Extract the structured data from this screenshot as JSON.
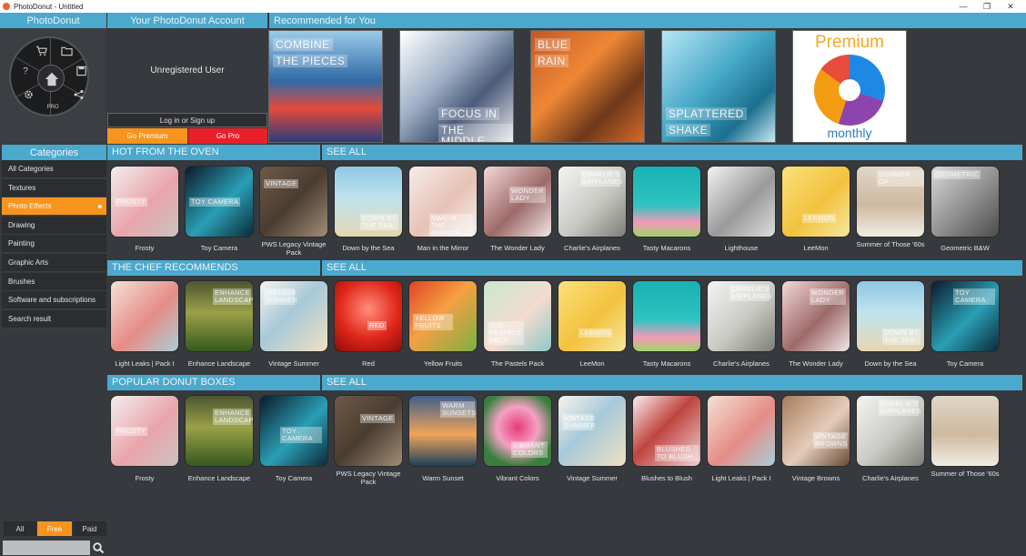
{
  "window": {
    "title": "PhotoDonut - Untitled",
    "controls": [
      "—",
      "❐",
      "✕"
    ]
  },
  "header": {
    "app_name": "PhotoDonut",
    "account": "Your PhotoDonut Account",
    "recommended": "Recommended for You"
  },
  "wheel": {
    "pro": "PRO",
    "help": "?"
  },
  "account": {
    "user": "Unregistered User",
    "login": "Log in or Sign up",
    "premium": "Go Premium",
    "pro": "Go Pro"
  },
  "recommended": [
    {
      "lines": [
        "COMBINE",
        "THE PIECES"
      ]
    },
    {
      "lines": [
        "FOCUS IN",
        "THE MIDDLE"
      ]
    },
    {
      "lines": [
        "BLUE",
        "RAIN"
      ]
    },
    {
      "lines": [
        "SPLATTERED",
        "SHAKE"
      ]
    }
  ],
  "premium_card": {
    "title": "Premium",
    "subtitle": "monthly"
  },
  "categories": {
    "title": "Categories",
    "items": [
      "All Categories",
      "Textures",
      "Photo Effects",
      "Drawing",
      "Painting",
      "Graphic Arts",
      "Brushes",
      "Software and subscriptions",
      "Search result"
    ],
    "active_index": 2
  },
  "filters": {
    "all": "All",
    "free": "Free",
    "paid": "Paid"
  },
  "search": {
    "placeholder": ""
  },
  "sections": [
    {
      "title": "HOT FROM THE OVEN",
      "see_all": "SEE ALL",
      "items": [
        {
          "label": "Frosty",
          "overlay": "FROSTY"
        },
        {
          "label": "Toy Camera",
          "overlay": "TOY CAMERA"
        },
        {
          "label": "PWS Legacy Vintage Pack",
          "overlay": "VINTAGE"
        },
        {
          "label": "Down by the Sea",
          "overlay": "DOWN BY THE SEA"
        },
        {
          "label": "Man in the Mirror",
          "overlay": "MAN IN THE MIRROR"
        },
        {
          "label": "The Wonder Lady",
          "overlay": "WONDER LADY"
        },
        {
          "label": "Charlie's Airplanes",
          "overlay": "CHARLIE'S AIRPLANES"
        },
        {
          "label": "Tasty Macarons",
          "overlay": ""
        },
        {
          "label": "Lighthouse",
          "overlay": ""
        },
        {
          "label": "LeeMon",
          "overlay": "LEEMON"
        },
        {
          "label": "Summer of Those '60s",
          "overlay": "SUMMER OF"
        },
        {
          "label": "Geometric B&W",
          "overlay": "GEOMETRIC"
        }
      ]
    },
    {
      "title": "THE CHEF RECOMMENDS",
      "see_all": "SEE ALL",
      "items": [
        {
          "label": "Light Leaks | Pack I",
          "overlay": ""
        },
        {
          "label": "Enhance Landscape",
          "overlay": "ENHANCE LANDSCAPE"
        },
        {
          "label": "Vintage Summer",
          "overlay": "VINTAGE SUMMER"
        },
        {
          "label": "Red",
          "overlay": "RED"
        },
        {
          "label": "Yellow Fruits",
          "overlay": "YELLOW FRUITS"
        },
        {
          "label": "The Pastels Pack",
          "overlay": "THE PASTELS PACK"
        },
        {
          "label": "LeeMon",
          "overlay": "LEEMON"
        },
        {
          "label": "Tasty Macarons",
          "overlay": ""
        },
        {
          "label": "Charlie's Airplanes",
          "overlay": "CHARLIE'S AIRPLANES"
        },
        {
          "label": "The Wonder Lady",
          "overlay": "WONDER LADY"
        },
        {
          "label": "Down by the Sea",
          "overlay": "DOWN BY THE SEA"
        },
        {
          "label": "Toy Camera",
          "overlay": "TOY CAMERA"
        }
      ]
    },
    {
      "title": "POPULAR DONUT BOXES",
      "see_all": "SEE ALL",
      "items": [
        {
          "label": "Frosty",
          "overlay": "FROSTY"
        },
        {
          "label": "Enhance Landscape",
          "overlay": "ENHANCE LANDSCAPE"
        },
        {
          "label": "Toy Camera",
          "overlay": "TOY CAMERA"
        },
        {
          "label": "PWS Legacy Vintage Pack",
          "overlay": "VINTAGE"
        },
        {
          "label": "Warm Sunset",
          "overlay": "WARM SUNSETS"
        },
        {
          "label": "Vibrant Colors",
          "overlay": "VIBRANT COLORS"
        },
        {
          "label": "Vintage Summer",
          "overlay": "VINTAGE SUMMER"
        },
        {
          "label": "Blushes to Blush",
          "overlay": "BLUSHES TO BLUSH"
        },
        {
          "label": "Light Leaks | Pack I",
          "overlay": ""
        },
        {
          "label": "Vintage Browns",
          "overlay": "VINTAGE BROWNS"
        },
        {
          "label": "Charlie's Airplanes",
          "overlay": "CHARLIE'S AIRPLANES"
        },
        {
          "label": "Summer of Those '60s",
          "overlay": ""
        }
      ]
    }
  ],
  "colors": {
    "accent": "#4aa9cd",
    "orange": "#f7941e",
    "red": "#e8202a",
    "background": "#36393d"
  }
}
